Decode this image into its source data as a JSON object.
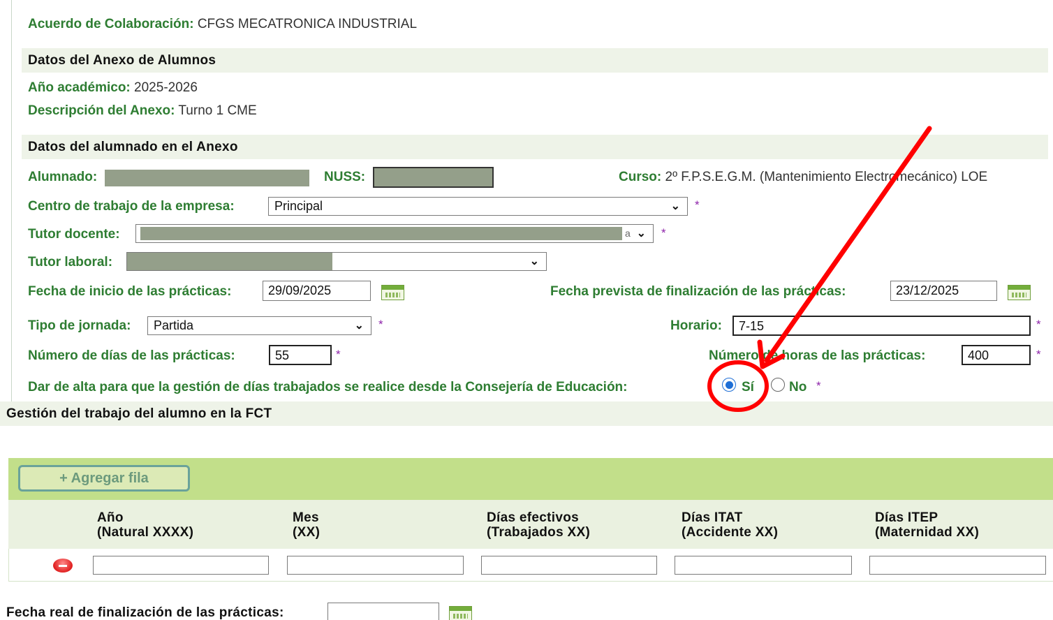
{
  "header": {
    "agreement_label": "Acuerdo de Colaboración:",
    "agreement_value": "CFGS MECATRONICA INDUSTRIAL"
  },
  "annex": {
    "section_title": "Datos del Anexo de Alumnos",
    "year_label": "Año académico:",
    "year_value": "2025-2026",
    "desc_label": "Descripción del Anexo:",
    "desc_value": "Turno 1 CME"
  },
  "student": {
    "section_title": "Datos del alumnado en el Anexo",
    "student_label": "Alumnado:",
    "nuss_label": "NUSS:",
    "course_label": "Curso:",
    "course_value": "2º F.P.S.E.G.M. (Mantenimiento Electromecánico) LOE",
    "workplace_label": "Centro de trabajo de la empresa:",
    "workplace_value": "Principal",
    "teacher_tutor_label": "Tutor docente:",
    "teacher_tutor_tail": "a",
    "work_tutor_label": "Tutor laboral:",
    "start_date_label": "Fecha de inicio de las prácticas:",
    "start_date_value": "29/09/2025",
    "end_date_label": "Fecha prevista de finalización de las prácticas:",
    "end_date_value": "23/12/2025",
    "workday_label": "Tipo de jornada:",
    "workday_value": "Partida",
    "schedule_label": "Horario:",
    "schedule_value": "7-15",
    "days_label": "Número de días de las prácticas:",
    "days_value": "55",
    "hours_label": "Número de horas de las prácticas:",
    "hours_value": "400",
    "consejeria_label": "Dar de alta para que la gestión de días trabajados se realice desde la Consejería de Educación:",
    "yes_label": "Sí",
    "no_label": "No",
    "yes_selected": true,
    "required_mark": "*"
  },
  "fct": {
    "section_title": "Gestión del trabajo del alumno en la FCT",
    "add_row_label": "+ Agregar fila",
    "columns": [
      {
        "line1": "Año",
        "line2": "(Natural XXXX)"
      },
      {
        "line1": "Mes",
        "line2": "(XX)"
      },
      {
        "line1": "Días efectivos",
        "line2": "(Trabajados XX)"
      },
      {
        "line1": "Días ITAT",
        "line2": "(Accidente XX)"
      },
      {
        "line1": "Días ITEP",
        "line2": "(Maternidad XX)"
      }
    ],
    "real_end_label": "Fecha real de finalización de las prácticas:"
  },
  "colors": {
    "label_green": "#2e7d32",
    "section_bg": "#eef3e8",
    "table_header_green": "#c2df8a",
    "annotation_red": "#ff0000",
    "radio_blue": "#1f6fd6",
    "required_purple": "#8e24aa"
  },
  "icons": [
    "calendar-icon",
    "chevron-down-icon",
    "remove-row-icon",
    "annotation-arrow",
    "annotation-circle"
  ]
}
